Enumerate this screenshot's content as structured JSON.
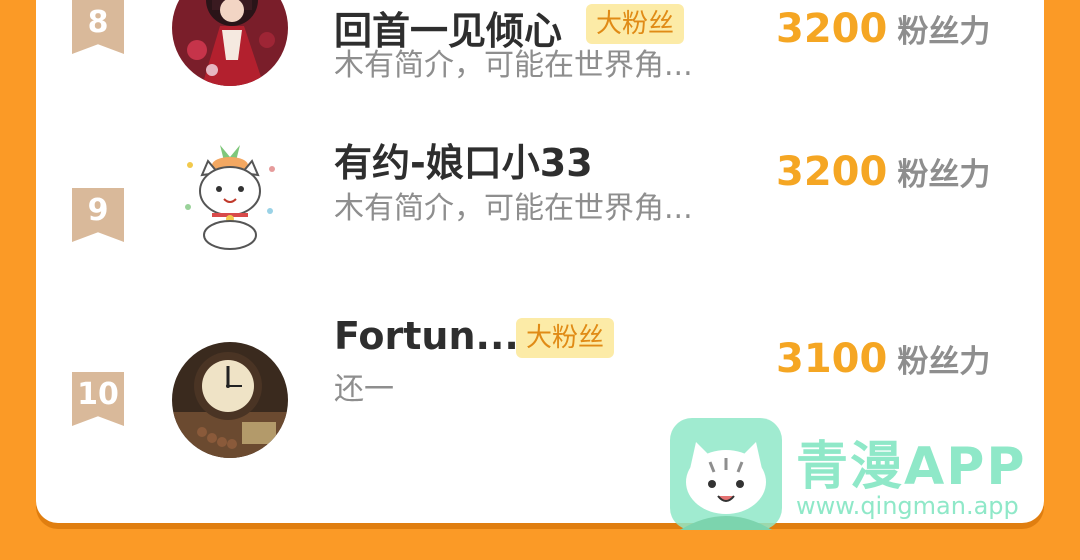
{
  "leaderboard": {
    "entries": [
      {
        "rank": "8",
        "name": "回首一见倾心",
        "badge": "大粉丝",
        "bio": "木有简介，可能在世界角...",
        "score": "3200",
        "score_unit": "粉丝力",
        "avatar_icon": "anime-girl-red-dress-avatar"
      },
      {
        "rank": "9",
        "name": "有约-娘口小33",
        "badge": "",
        "bio": "木有简介，可能在世界角...",
        "score": "3200",
        "score_unit": "粉丝力",
        "avatar_icon": "cartoon-cat-avatar"
      },
      {
        "rank": "10",
        "name": "Fortun...",
        "badge": "大粉丝",
        "bio": "还一",
        "score": "3100",
        "score_unit": "粉丝力",
        "avatar_icon": "antique-clock-avatar"
      }
    ]
  },
  "watermark": {
    "title": "青漫APP",
    "url": "www.qingman.app",
    "logo_icon": "cat-mascot-logo"
  },
  "colors": {
    "page_background": "#FB9A26",
    "card_background": "#FFFFFF",
    "rank_ribbon": "#D9B99A",
    "score": "#F5A623",
    "badge_background": "#FCEBA7",
    "badge_text": "#E08B16",
    "watermark": "#8FE8C8"
  }
}
